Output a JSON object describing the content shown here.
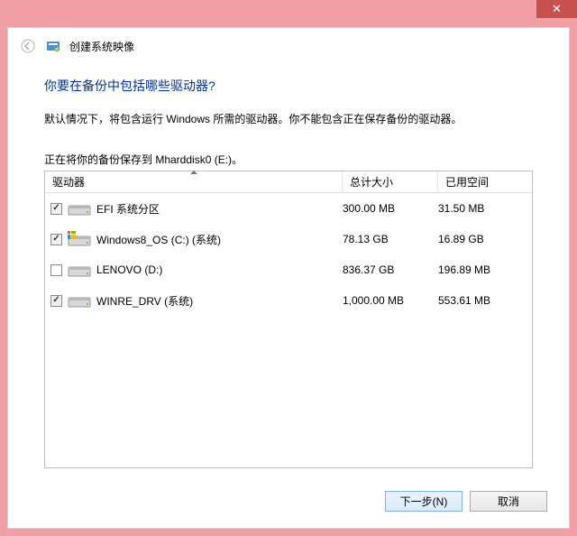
{
  "window": {
    "title": "创建系统映像"
  },
  "content": {
    "question": "你要在备份中包括哪些驱动器?",
    "description": "默认情况下，将包含运行 Windows 所需的驱动器。你不能包含正在保存备份的驱动器。",
    "saving_to": "正在将你的备份保存到 Mharddisk0 (E:)。"
  },
  "table": {
    "headers": {
      "drive": "驱动器",
      "total_size": "总计大小",
      "used_space": "已用空间"
    },
    "rows": [
      {
        "checked": true,
        "disabled": true,
        "has_win_overlay": false,
        "label": "EFI 系统分区",
        "total_size": "300.00 MB",
        "used_space": "31.50 MB"
      },
      {
        "checked": true,
        "disabled": true,
        "has_win_overlay": true,
        "label": "Windows8_OS (C:) (系统)",
        "total_size": "78.13 GB",
        "used_space": "16.89 GB"
      },
      {
        "checked": false,
        "disabled": false,
        "has_win_overlay": false,
        "label": "LENOVO (D:)",
        "total_size": "836.37 GB",
        "used_space": "196.89 MB"
      },
      {
        "checked": true,
        "disabled": true,
        "has_win_overlay": false,
        "label": "WINRE_DRV (系统)",
        "total_size": "1,000.00 MB",
        "used_space": "553.61 MB"
      }
    ]
  },
  "buttons": {
    "next": "下一步(N)",
    "cancel": "取消"
  }
}
